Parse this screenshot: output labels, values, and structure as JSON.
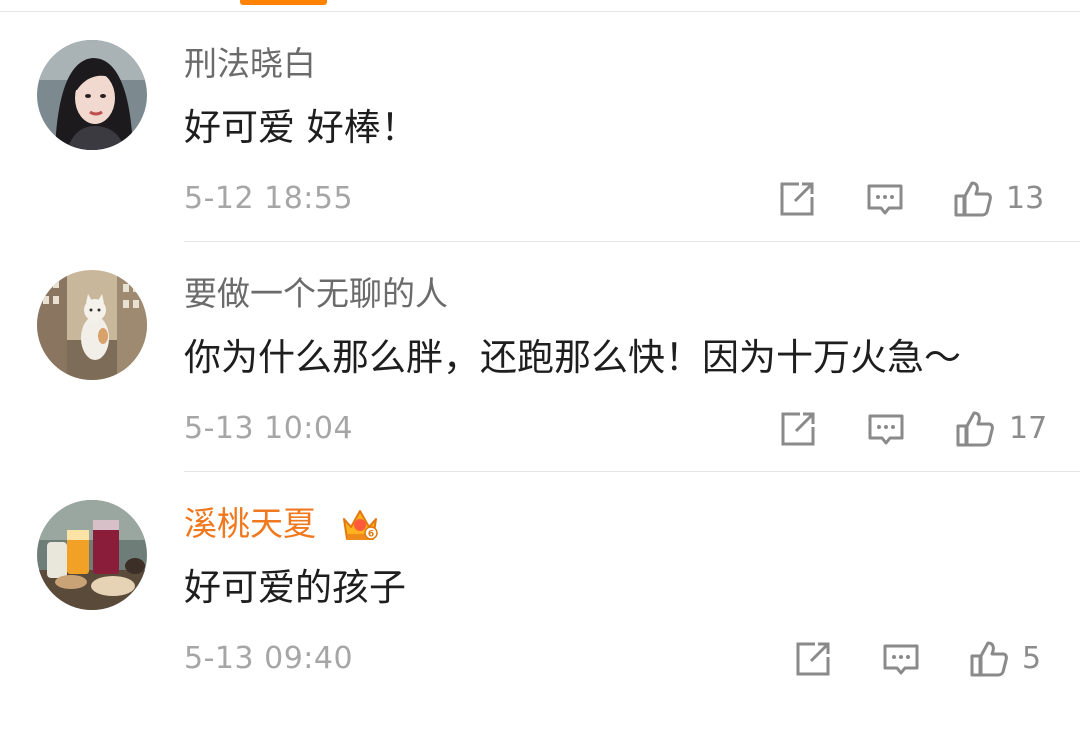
{
  "comments": [
    {
      "username": "刑法晓白",
      "content": "好可爱 好棒！",
      "time": "5-12 18:55",
      "likes": "13",
      "avatar": "woman-portrait-avatar"
    },
    {
      "username": "要做一个无聊的人",
      "content": "你为什么那么胖，还跑那么快！因为十万火急～",
      "time": "5-13 10:04",
      "likes": "17",
      "avatar": "cat-city-avatar"
    },
    {
      "username": "溪桃天夏",
      "content": "好可爱的孩子",
      "time": "5-13 09:40",
      "likes": "5",
      "avatar": "drinks-avatar",
      "badge": "vip-crown-icon"
    }
  ],
  "icons": {
    "repost": "share-icon",
    "comment": "comment-icon",
    "like": "thumbs-up-icon"
  },
  "colors": {
    "accent": "#ff8200",
    "vip_name": "#f0781e",
    "username": "#6b6b6b",
    "content": "#1e1e1e",
    "meta": "#a6a6a6"
  }
}
